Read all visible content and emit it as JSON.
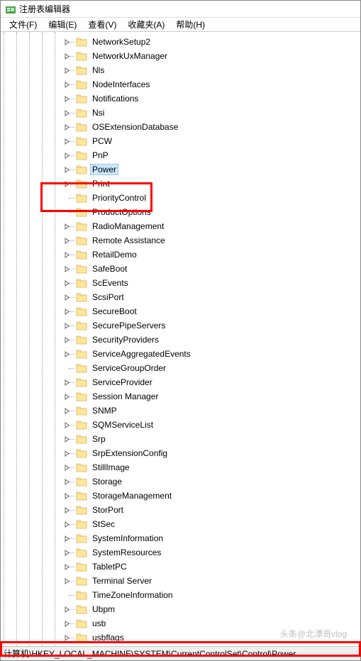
{
  "titlebar": {
    "title": "注册表编辑器"
  },
  "menubar": {
    "file": "文件(F)",
    "edit": "编辑(E)",
    "view": "查看(V)",
    "favorites": "收藏夹(A)",
    "help": "帮助(H)"
  },
  "tree": {
    "items": [
      {
        "label": "NetworkSetup2",
        "expandable": true
      },
      {
        "label": "NetworkUxManager",
        "expandable": true
      },
      {
        "label": "Nls",
        "expandable": true
      },
      {
        "label": "NodeInterfaces",
        "expandable": true
      },
      {
        "label": "Notifications",
        "expandable": true
      },
      {
        "label": "Nsi",
        "expandable": true
      },
      {
        "label": "OSExtensionDatabase",
        "expandable": true
      },
      {
        "label": "PCW",
        "expandable": true
      },
      {
        "label": "PnP",
        "expandable": true
      },
      {
        "label": "Power",
        "expandable": true,
        "selected": true
      },
      {
        "label": "Print",
        "expandable": true
      },
      {
        "label": "PriorityControl",
        "expandable": false
      },
      {
        "label": "ProductOptions",
        "expandable": false
      },
      {
        "label": "RadioManagement",
        "expandable": true
      },
      {
        "label": "Remote Assistance",
        "expandable": true
      },
      {
        "label": "RetailDemo",
        "expandable": true
      },
      {
        "label": "SafeBoot",
        "expandable": true
      },
      {
        "label": "ScEvents",
        "expandable": true
      },
      {
        "label": "ScsiPort",
        "expandable": true
      },
      {
        "label": "SecureBoot",
        "expandable": true
      },
      {
        "label": "SecurePipeServers",
        "expandable": true
      },
      {
        "label": "SecurityProviders",
        "expandable": true
      },
      {
        "label": "ServiceAggregatedEvents",
        "expandable": true
      },
      {
        "label": "ServiceGroupOrder",
        "expandable": false
      },
      {
        "label": "ServiceProvider",
        "expandable": true
      },
      {
        "label": "Session Manager",
        "expandable": true
      },
      {
        "label": "SNMP",
        "expandable": true
      },
      {
        "label": "SQMServiceList",
        "expandable": true
      },
      {
        "label": "Srp",
        "expandable": true
      },
      {
        "label": "SrpExtensionConfig",
        "expandable": true
      },
      {
        "label": "StillImage",
        "expandable": true
      },
      {
        "label": "Storage",
        "expandable": true
      },
      {
        "label": "StorageManagement",
        "expandable": true
      },
      {
        "label": "StorPort",
        "expandable": true
      },
      {
        "label": "StSec",
        "expandable": true
      },
      {
        "label": "SystemInformation",
        "expandable": true
      },
      {
        "label": "SystemResources",
        "expandable": true
      },
      {
        "label": "TabletPC",
        "expandable": true
      },
      {
        "label": "Terminal Server",
        "expandable": true
      },
      {
        "label": "TimeZoneInformation",
        "expandable": false
      },
      {
        "label": "Ubpm",
        "expandable": true
      },
      {
        "label": "usb",
        "expandable": true
      },
      {
        "label": "usbflags",
        "expandable": true
      }
    ]
  },
  "statusbar": {
    "path": "计算机\\HKEY_LOCAL_MACHINE\\SYSTEM\\CurrentControlSet\\Control\\Power"
  },
  "watermark": "头条@北漂哥vlog"
}
